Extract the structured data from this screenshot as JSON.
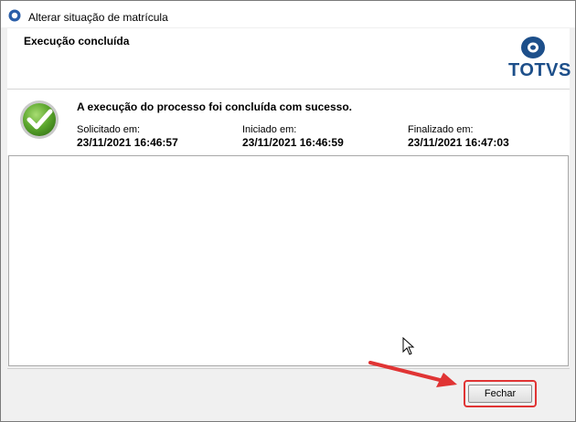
{
  "window": {
    "title": "Alterar situação de matrícula"
  },
  "header": {
    "title": "Execução concluída",
    "logo_text": "TOTVS"
  },
  "status": {
    "message": "A execução do processo foi concluída com sucesso.",
    "times": [
      {
        "label": "Solicitado em:",
        "value": "23/11/2021 16:46:57"
      },
      {
        "label": "Iniciado em:",
        "value": "23/11/2021 16:46:59"
      },
      {
        "label": "Finalizado em:",
        "value": "23/11/2021 16:47:03"
      }
    ]
  },
  "log": {
    "content": ""
  },
  "footer": {
    "close_label": "Fechar"
  },
  "colors": {
    "brand": "#1d4f8a",
    "highlight": "#e03434",
    "success": "#5aa52c"
  }
}
